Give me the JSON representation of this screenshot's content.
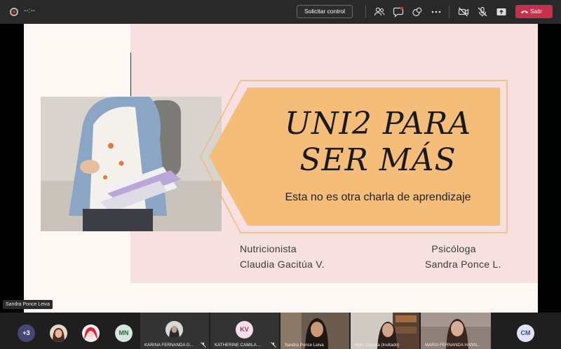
{
  "topbar": {
    "timer": "--:--",
    "request_control_label": "Solicitar control",
    "leave_label": "Salir",
    "icons": [
      "record-icon",
      "participants-icon",
      "chat-icon",
      "reactions-icon",
      "more-icon",
      "camera-off-icon",
      "mic-off-icon",
      "share-icon",
      "hangup-icon"
    ]
  },
  "slide": {
    "title_line1": "UNI2 PARA",
    "title_line2": "SER MÁS",
    "subtitle": "Esta no es otra charla de aprendizaje",
    "left_role": "Nutricionista",
    "left_name": "Claudia Gacitúa V.",
    "right_role": "Psicóloga",
    "right_name": "Sandra Ponce L.",
    "colors": {
      "pink": "#f7e1e0",
      "banner": "#f5bd7a",
      "cream": "#fdf8f4"
    }
  },
  "speaker_label": "Sandra Ponce Leiva",
  "participants": {
    "overflow_count": "+3",
    "initials_mn": "MN",
    "initials_kv": "KV",
    "initials_cm": "CM",
    "tile_names": [
      "KARINA FERNANDA G...",
      "KATHERINE CAMILA ...",
      "Sandra Ponce Leiva",
      "Nutri Claudia (Invitado)",
      "MARIA FERNANDA HANN..."
    ]
  }
}
